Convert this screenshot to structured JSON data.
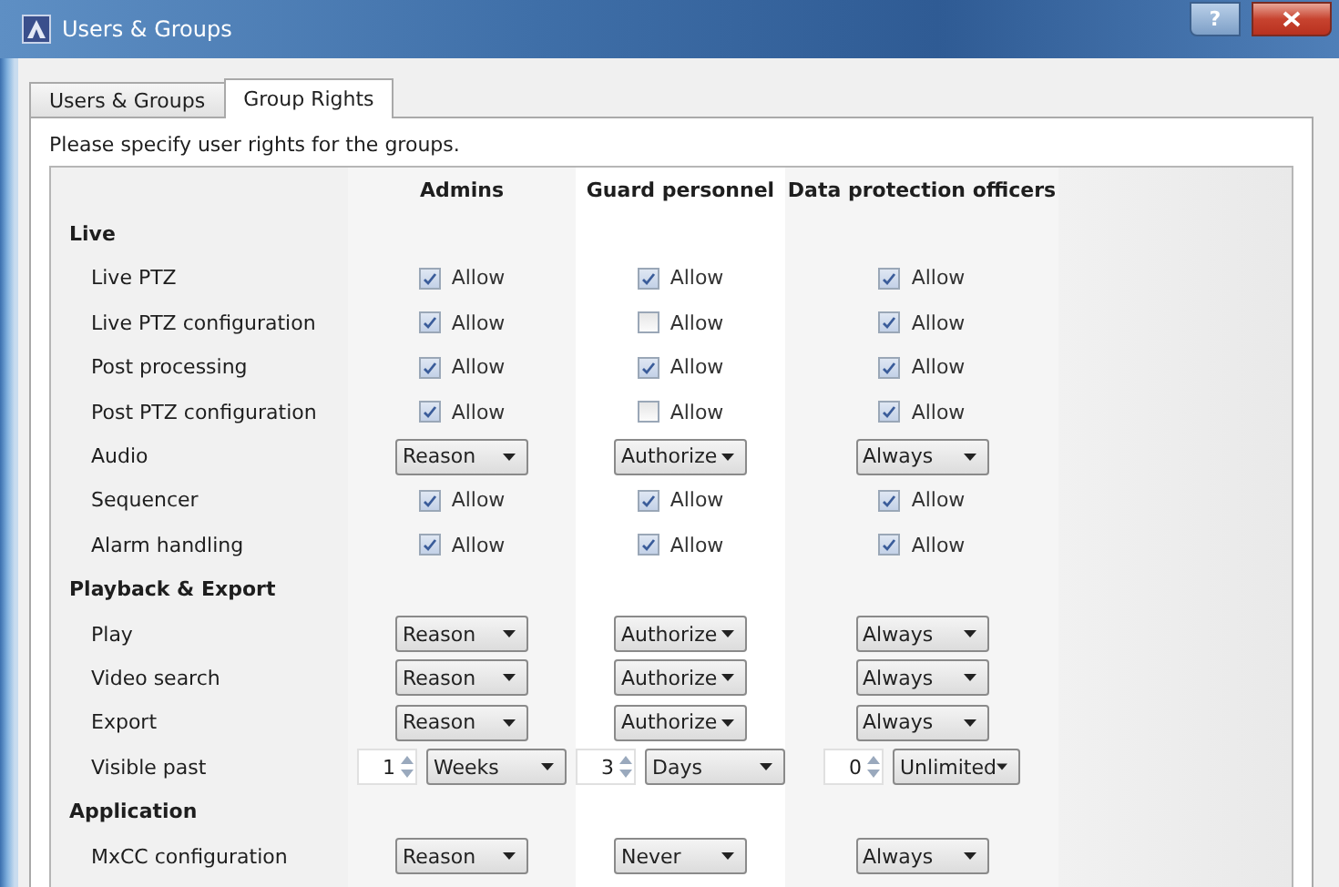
{
  "window": {
    "title": "Users & Groups",
    "help_button": "?"
  },
  "tabs": [
    {
      "label": "Users & Groups",
      "selected": false
    },
    {
      "label": "Group Rights",
      "selected": true
    }
  ],
  "instruction": "Please specify user rights for the groups.",
  "columns": [
    "Admins",
    "Guard personnel",
    "Data protection officers"
  ],
  "sections": [
    {
      "title": "Live",
      "rows": [
        {
          "label": "Live PTZ",
          "cells": [
            {
              "kind": "checkbox",
              "checked": true,
              "text": "Allow"
            },
            {
              "kind": "checkbox",
              "checked": true,
              "text": "Allow"
            },
            {
              "kind": "checkbox",
              "checked": true,
              "text": "Allow"
            }
          ]
        },
        {
          "label": "Live PTZ configuration",
          "cells": [
            {
              "kind": "checkbox",
              "checked": true,
              "text": "Allow"
            },
            {
              "kind": "checkbox",
              "checked": false,
              "text": "Allow"
            },
            {
              "kind": "checkbox",
              "checked": true,
              "text": "Allow"
            }
          ]
        },
        {
          "label": "Post processing",
          "cells": [
            {
              "kind": "checkbox",
              "checked": true,
              "text": "Allow"
            },
            {
              "kind": "checkbox",
              "checked": true,
              "text": "Allow"
            },
            {
              "kind": "checkbox",
              "checked": true,
              "text": "Allow"
            }
          ]
        },
        {
          "label": "Post PTZ configuration",
          "cells": [
            {
              "kind": "checkbox",
              "checked": true,
              "text": "Allow"
            },
            {
              "kind": "checkbox",
              "checked": false,
              "text": "Allow"
            },
            {
              "kind": "checkbox",
              "checked": true,
              "text": "Allow"
            }
          ]
        },
        {
          "label": "Audio",
          "cells": [
            {
              "kind": "dropdown",
              "value": "Reason"
            },
            {
              "kind": "dropdown",
              "value": "Authorize"
            },
            {
              "kind": "dropdown",
              "value": "Always"
            }
          ]
        },
        {
          "label": "Sequencer",
          "cells": [
            {
              "kind": "checkbox",
              "checked": true,
              "text": "Allow"
            },
            {
              "kind": "checkbox",
              "checked": true,
              "text": "Allow"
            },
            {
              "kind": "checkbox",
              "checked": true,
              "text": "Allow"
            }
          ]
        },
        {
          "label": "Alarm handling",
          "cells": [
            {
              "kind": "checkbox",
              "checked": true,
              "text": "Allow"
            },
            {
              "kind": "checkbox",
              "checked": true,
              "text": "Allow"
            },
            {
              "kind": "checkbox",
              "checked": true,
              "text": "Allow"
            }
          ]
        }
      ]
    },
    {
      "title": "Playback & Export",
      "rows": [
        {
          "label": "Play",
          "cells": [
            {
              "kind": "dropdown",
              "value": "Reason"
            },
            {
              "kind": "dropdown",
              "value": "Authorize"
            },
            {
              "kind": "dropdown",
              "value": "Always"
            }
          ]
        },
        {
          "label": "Video search",
          "cells": [
            {
              "kind": "dropdown",
              "value": "Reason"
            },
            {
              "kind": "dropdown",
              "value": "Authorize"
            },
            {
              "kind": "dropdown",
              "value": "Always"
            }
          ]
        },
        {
          "label": "Export",
          "cells": [
            {
              "kind": "dropdown",
              "value": "Reason"
            },
            {
              "kind": "dropdown",
              "value": "Authorize"
            },
            {
              "kind": "dropdown",
              "value": "Always"
            }
          ]
        },
        {
          "label": "Visible past",
          "cells": [
            {
              "kind": "duration",
              "number": "1",
              "unit": "Weeks"
            },
            {
              "kind": "duration",
              "number": "3",
              "unit": "Days"
            },
            {
              "kind": "duration",
              "number": "0",
              "unit": "Unlimited"
            }
          ]
        }
      ]
    },
    {
      "title": "Application",
      "rows": [
        {
          "label": "MxCC configuration",
          "cells": [
            {
              "kind": "dropdown",
              "value": "Reason"
            },
            {
              "kind": "dropdown",
              "value": "Never"
            },
            {
              "kind": "dropdown",
              "value": "Always"
            }
          ]
        }
      ]
    }
  ]
}
